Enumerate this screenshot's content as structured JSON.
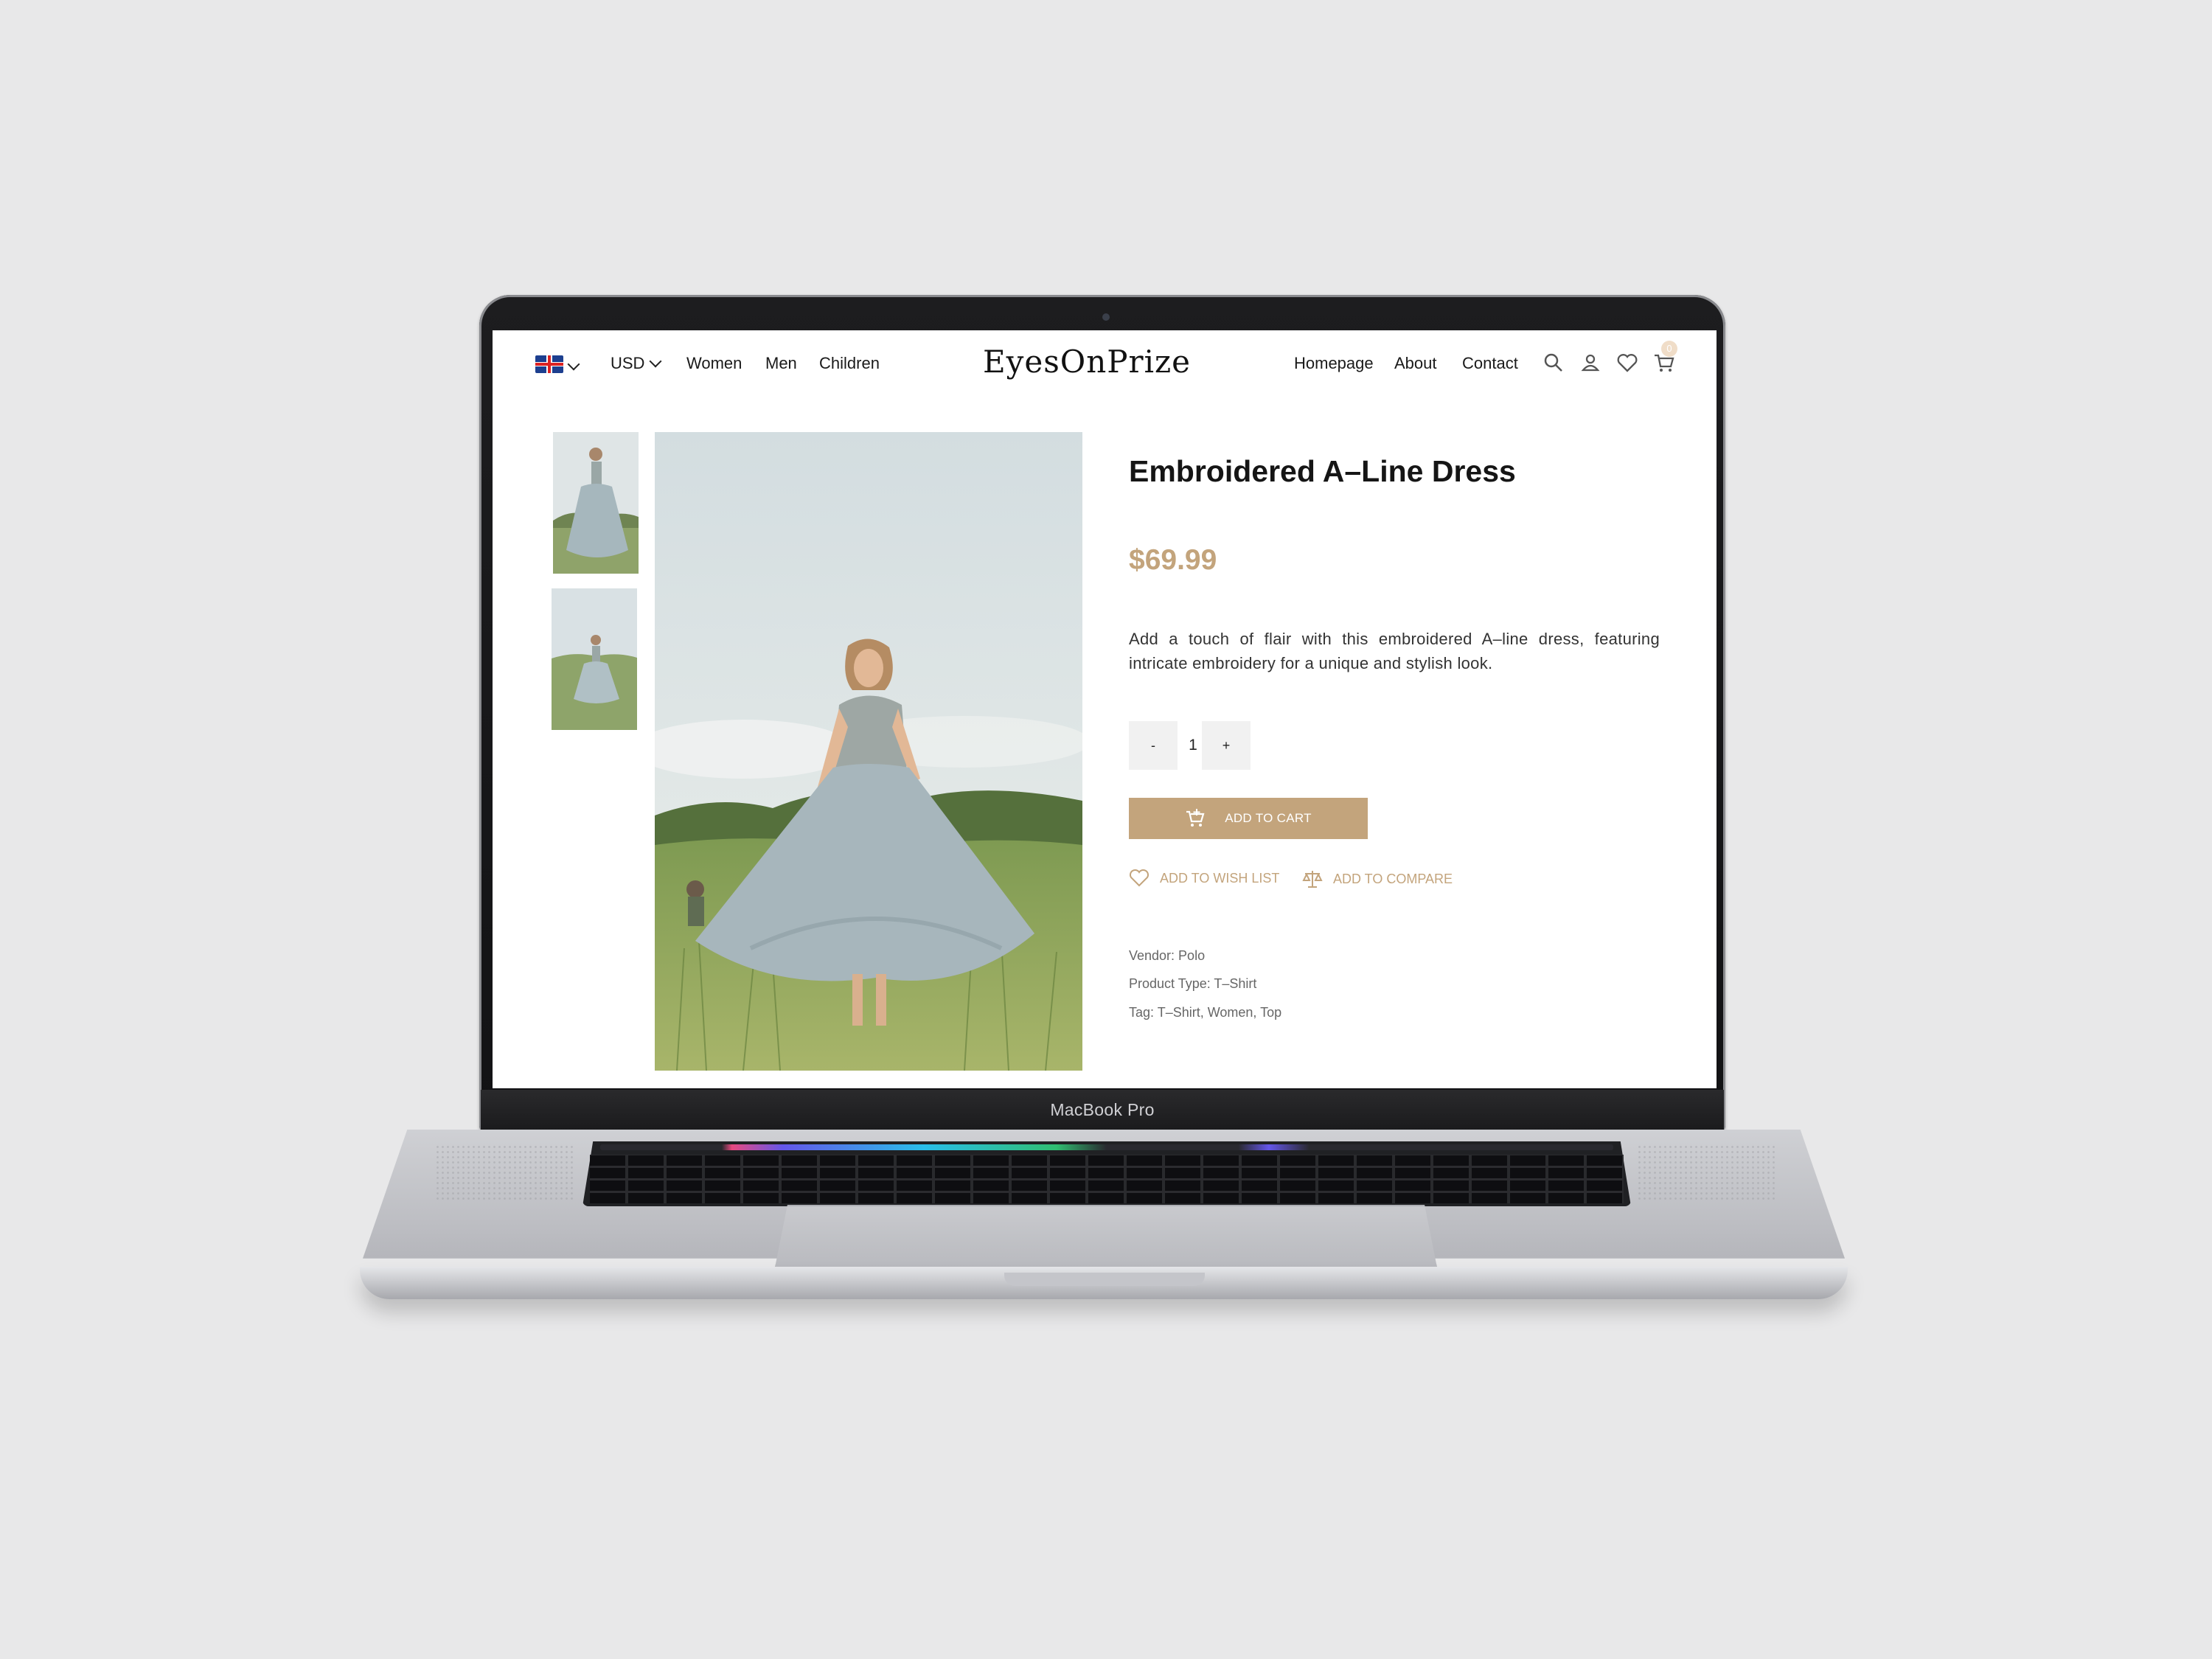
{
  "device_label": "MacBook Pro",
  "header": {
    "currency": "USD",
    "nav_left": [
      "Women",
      "Men",
      "Children"
    ],
    "logo": "EyesOnPrize",
    "nav_right": [
      "Homepage",
      "About",
      "Contact"
    ],
    "icons": [
      "search-icon",
      "user-icon",
      "heart-icon",
      "cart-icon"
    ],
    "cart_count": "0"
  },
  "product": {
    "title": "Embroidered A–Line Dress",
    "price": "$69.99",
    "description": "Add a touch of flair with this embroidered A–line dress, featuring intricate embroidery for a unique and stylish look.",
    "quantity": "1",
    "minus_label": "-",
    "plus_label": "+",
    "add_to_cart_label": "ADD TO CART",
    "wish_list_label": "ADD TO WISH LIST",
    "compare_label": "ADD TO COMPARE",
    "vendor": "Vendor: Polo",
    "product_type": "Product Type: T–Shirt",
    "tags": "Tag: T–Shirt, Women, Top"
  },
  "colors": {
    "accent": "#c3a47c",
    "text": "#151515",
    "background": "#ffffff"
  }
}
